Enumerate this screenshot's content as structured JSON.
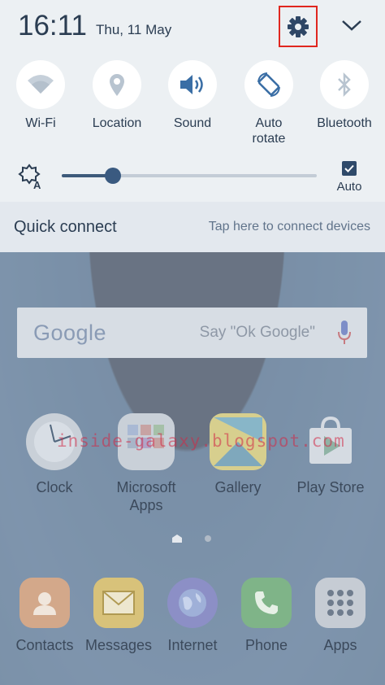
{
  "status": {
    "time": "16:11",
    "date": "Thu, 11 May"
  },
  "quick_toggles": [
    {
      "label": "Wi-Fi",
      "icon": "wifi-icon",
      "active": false
    },
    {
      "label": "Location",
      "icon": "location-icon",
      "active": false
    },
    {
      "label": "Sound",
      "icon": "sound-icon",
      "active": true
    },
    {
      "label": "Auto\nrotate",
      "icon": "auto-rotate-icon",
      "active": true
    },
    {
      "label": "Bluetooth",
      "icon": "bluetooth-icon",
      "active": false
    }
  ],
  "brightness": {
    "level": 0.2,
    "auto_label": "Auto",
    "auto_checked": true
  },
  "quick_connect": {
    "title": "Quick connect",
    "hint": "Tap here to connect devices"
  },
  "search": {
    "logo": "Google",
    "hint": "Say \"Ok Google\""
  },
  "watermark": "inside-galaxy.blogspot.com",
  "apps": [
    {
      "label": "Clock",
      "icon": "clock-icon"
    },
    {
      "label": "Microsoft\nApps",
      "icon": "microsoft-apps-icon"
    },
    {
      "label": "Gallery",
      "icon": "gallery-icon"
    },
    {
      "label": "Play Store",
      "icon": "play-store-icon"
    }
  ],
  "dock": [
    {
      "label": "Contacts",
      "icon": "contacts-icon"
    },
    {
      "label": "Messages",
      "icon": "messages-icon"
    },
    {
      "label": "Internet",
      "icon": "internet-icon"
    },
    {
      "label": "Phone",
      "icon": "phone-icon"
    },
    {
      "label": "Apps",
      "icon": "apps-grid-icon"
    }
  ],
  "colors": {
    "accent": "#3d5a7a",
    "highlight_box": "#e0271f",
    "inactive_icon": "#b8c4d0"
  }
}
